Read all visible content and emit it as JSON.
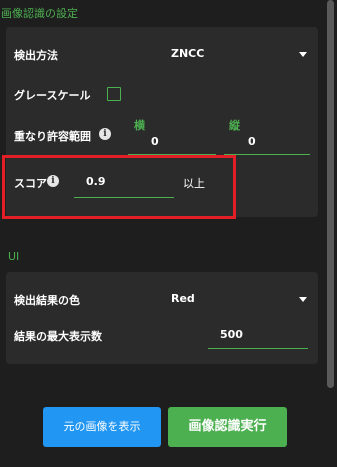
{
  "image_recognition_settings": {
    "title": "画像認識の設定",
    "detection_method": {
      "label": "検出方法",
      "value": "ZNCC"
    },
    "grayscale": {
      "label": "グレースケール",
      "checked": false
    },
    "overlap_tolerance": {
      "label": "重なり許容範囲",
      "horizontal_label": "横",
      "horizontal_value": "0",
      "vertical_label": "縦",
      "vertical_value": "0"
    },
    "score": {
      "label": "スコア",
      "value": "0.9",
      "suffix": "以上"
    }
  },
  "ui_settings": {
    "title": "UI",
    "result_color": {
      "label": "検出結果の色",
      "value": "Red"
    },
    "max_results": {
      "label": "結果の最大表示数",
      "value": "500"
    }
  },
  "buttons": {
    "show_original": "元の画像を表示",
    "run_recognition": "画像認識実行"
  },
  "colors": {
    "accent": "#4caf50",
    "highlight": "#e21f26",
    "primary_button": "#2196f3",
    "success_button": "#4caf50"
  },
  "icons": {
    "info": "info-icon",
    "dropdown": "chevron-down-icon"
  }
}
